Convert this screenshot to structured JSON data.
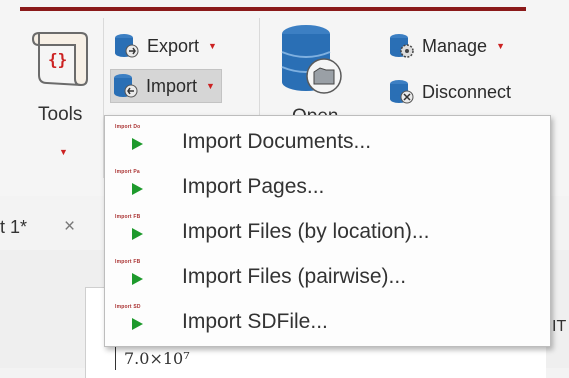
{
  "ribbon": {
    "tools": {
      "label": "Tools",
      "icon": "script-scroll-icon"
    },
    "export": {
      "label": "Export",
      "icon": "database-export-icon"
    },
    "import": {
      "label": "Import",
      "icon": "database-import-icon"
    },
    "open": {
      "label": "Open",
      "icon": "database-open-icon"
    },
    "manage": {
      "label": "Manage",
      "icon": "database-manage-icon"
    },
    "disconnect": {
      "label": "Disconnect",
      "icon": "database-disconnect-icon"
    }
  },
  "tab": {
    "title": "t 1*",
    "close": "×"
  },
  "import_menu": {
    "items": [
      {
        "label": "Import Documents...",
        "mini": "Import Do"
      },
      {
        "label": "Import Pages...",
        "mini": "Import Pa"
      },
      {
        "label": "Import Files (by location)...",
        "mini": "Import FB"
      },
      {
        "label": "Import Files (pairwise)...",
        "mini": "Import FB"
      },
      {
        "label": "Import SDFile...",
        "mini": "Import SD"
      }
    ]
  },
  "document": {
    "tick_label": "7.0×10⁷",
    "edge_text": "IT"
  },
  "colors": {
    "accent": "#8b1a1a",
    "caret": "#cc2222",
    "play": "#1d9a2c",
    "db_blue": "#2a6fb5"
  }
}
